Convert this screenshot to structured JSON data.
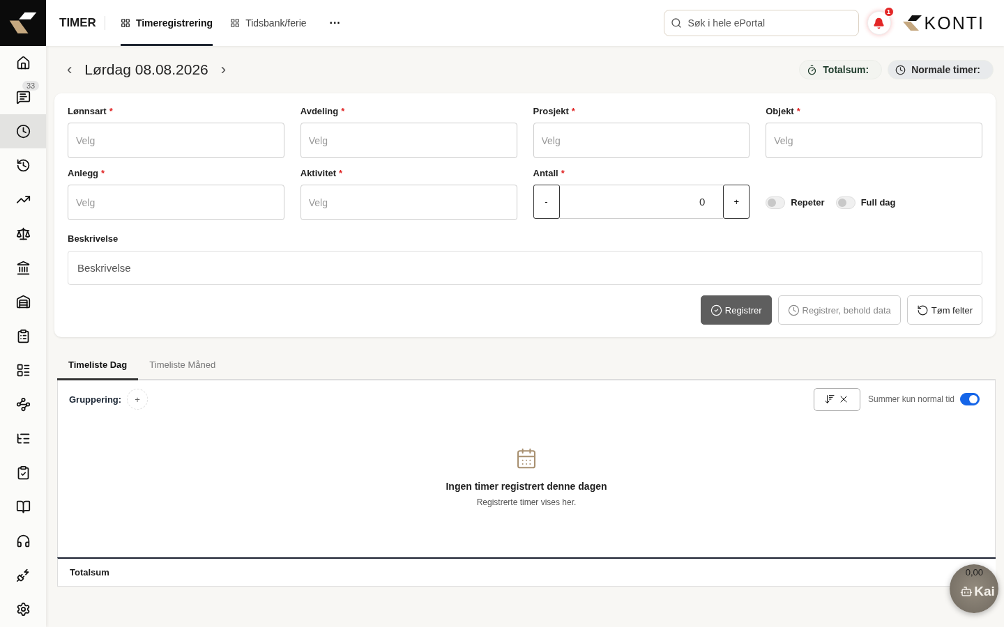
{
  "header": {
    "section": "TIMER",
    "tabs": [
      {
        "label": "Timeregistrering",
        "selected": true
      },
      {
        "label": "Tidsbank/ferie",
        "selected": false
      }
    ],
    "more": "···",
    "search": {
      "placeholder": "Søk i hele ePortal"
    },
    "notifications": "1",
    "brand": "KONTI"
  },
  "sidebar": [
    {
      "kind": "home",
      "selected": false
    },
    {
      "kind": "messages",
      "selected": false,
      "badge": "33"
    },
    {
      "kind": "clock",
      "selected": true
    },
    {
      "kind": "clock-check",
      "selected": false
    },
    {
      "kind": "trend",
      "selected": false
    },
    {
      "kind": "scale",
      "selected": false
    },
    {
      "kind": "bank",
      "selected": false
    },
    {
      "kind": "building",
      "selected": false
    },
    {
      "kind": "clipboard",
      "selected": false
    },
    {
      "kind": "list",
      "selected": false
    },
    {
      "kind": "network",
      "selected": false
    },
    {
      "kind": "tree",
      "selected": false
    },
    {
      "kind": "clipboard-check",
      "selected": false
    },
    {
      "kind": "book",
      "selected": false
    },
    {
      "kind": "headphones",
      "selected": false
    },
    {
      "kind": "plug",
      "selected": false
    },
    {
      "kind": "settings",
      "selected": false
    }
  ],
  "date_bar": {
    "prev": "‹",
    "date": "Lørdag 08.08.2026",
    "next": "›",
    "chips": [
      {
        "kind": "timer",
        "label": "Totalsum:"
      },
      {
        "kind": "clock",
        "label": "Normale timer:"
      }
    ]
  },
  "form": {
    "fields": [
      {
        "kind": "select",
        "label": "Lønnsart",
        "mark": "*",
        "placeholder": "Velg"
      },
      {
        "kind": "select",
        "label": "Avdeling",
        "mark": "*",
        "placeholder": "Velg"
      },
      {
        "kind": "select",
        "label": "Prosjekt",
        "mark": "*",
        "placeholder": "Velg"
      },
      {
        "kind": "select",
        "label": "Objekt",
        "mark": "*",
        "placeholder": "Velg"
      },
      {
        "kind": "select",
        "label": "Anlegg",
        "mark": "*",
        "placeholder": "Velg"
      },
      {
        "kind": "select",
        "label": "Aktivitet",
        "mark": "*",
        "placeholder": "Velg"
      },
      {
        "kind": "stepper",
        "label": "Antall",
        "mark": "*",
        "value": "0",
        "minus": "-",
        "plus": "+"
      },
      {
        "kind": "toggles",
        "items": [
          {
            "label": "Repeter",
            "on": false
          },
          {
            "label": "Full dag",
            "on": false
          }
        ]
      }
    ],
    "description": {
      "label": "Beskrivelse",
      "placeholder": "Beskrivelse"
    },
    "buttons": [
      {
        "kind": "primary",
        "label": "Registrer"
      },
      {
        "kind": "keep",
        "label": "Registrer, behold data"
      },
      {
        "kind": "reset",
        "label": "Tøm felter"
      }
    ]
  },
  "list": {
    "tabs": [
      {
        "label": "Timeliste Dag",
        "selected": true
      },
      {
        "label": "Timeliste Måned",
        "selected": false
      }
    ],
    "grouping": {
      "label": "Gruppering:",
      "add": "+"
    },
    "sum_toggle": {
      "label": "Summer kun normal tid",
      "on": true
    },
    "empty": {
      "title": "Ingen timer registrert denne dagen",
      "text": "Registrerte timer vises her."
    },
    "total": {
      "label": "Totalsum",
      "value": "0,00"
    }
  },
  "assistant": {
    "label": "Kai"
  }
}
